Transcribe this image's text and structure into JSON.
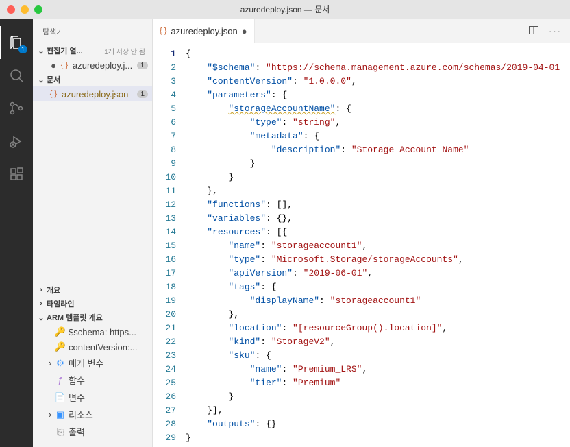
{
  "titlebar": {
    "title": "azuredeploy.json — 문서"
  },
  "activity": {
    "explorer_badge": "1"
  },
  "sidebar": {
    "title": "탐색기",
    "open_editors": {
      "label": "편집기 열...",
      "status": "1개 저장 안 됨",
      "file": "azuredeploy.j...",
      "count": "1"
    },
    "workspace": {
      "label": "문서",
      "file": "azuredeploy.json",
      "count": "1"
    },
    "outline_label": "개요",
    "timeline_label": "타임라인",
    "arm": {
      "label": "ARM 템플릿 개요",
      "items": [
        {
          "icon": "key",
          "label": "$schema: https..."
        },
        {
          "icon": "key",
          "label": "contentVersion:..."
        },
        {
          "icon": "gear",
          "label": "매개 변수",
          "expandable": true
        },
        {
          "icon": "func",
          "label": "함수"
        },
        {
          "icon": "doc",
          "label": "변수"
        },
        {
          "icon": "cube",
          "label": "리소스",
          "expandable": true
        },
        {
          "icon": "out",
          "label": "출력"
        }
      ]
    }
  },
  "tab": {
    "filename": "azuredeploy.json"
  },
  "code": {
    "lines": [
      {
        "n": 1,
        "t": [
          [
            "p",
            "{"
          ]
        ]
      },
      {
        "n": 2,
        "t": [
          [
            "p",
            "    "
          ],
          [
            "k",
            "\"$schema\""
          ],
          [
            "p",
            ": "
          ],
          [
            "url",
            "\"https://schema.management.azure.com/schemas/2019-04-01"
          ]
        ]
      },
      {
        "n": 3,
        "t": [
          [
            "p",
            "    "
          ],
          [
            "k",
            "\"contentVersion\""
          ],
          [
            "p",
            ": "
          ],
          [
            "s",
            "\"1.0.0.0\""
          ],
          [
            "p",
            ","
          ]
        ]
      },
      {
        "n": 4,
        "t": [
          [
            "p",
            "    "
          ],
          [
            "k",
            "\"parameters\""
          ],
          [
            "p",
            ": {"
          ]
        ]
      },
      {
        "n": 5,
        "t": [
          [
            "p",
            "        "
          ],
          [
            "ksq",
            "\"storageAccountName\""
          ],
          [
            "p",
            ": {"
          ]
        ]
      },
      {
        "n": 6,
        "t": [
          [
            "p",
            "            "
          ],
          [
            "k",
            "\"type\""
          ],
          [
            "p",
            ": "
          ],
          [
            "s",
            "\"string\""
          ],
          [
            "p",
            ","
          ]
        ]
      },
      {
        "n": 7,
        "t": [
          [
            "p",
            "            "
          ],
          [
            "k",
            "\"metadata\""
          ],
          [
            "p",
            ": {"
          ]
        ]
      },
      {
        "n": 8,
        "t": [
          [
            "p",
            "                "
          ],
          [
            "k",
            "\"description\""
          ],
          [
            "p",
            ": "
          ],
          [
            "s",
            "\"Storage Account Name\""
          ]
        ]
      },
      {
        "n": 9,
        "t": [
          [
            "p",
            "            }"
          ]
        ]
      },
      {
        "n": 10,
        "t": [
          [
            "p",
            "        }"
          ]
        ]
      },
      {
        "n": 11,
        "t": [
          [
            "p",
            "    },"
          ]
        ]
      },
      {
        "n": 12,
        "t": [
          [
            "p",
            "    "
          ],
          [
            "k",
            "\"functions\""
          ],
          [
            "p",
            ": [],"
          ]
        ]
      },
      {
        "n": 13,
        "t": [
          [
            "p",
            "    "
          ],
          [
            "k",
            "\"variables\""
          ],
          [
            "p",
            ": {},"
          ]
        ]
      },
      {
        "n": 14,
        "t": [
          [
            "p",
            "    "
          ],
          [
            "k",
            "\"resources\""
          ],
          [
            "p",
            ": [{"
          ]
        ]
      },
      {
        "n": 15,
        "t": [
          [
            "p",
            "        "
          ],
          [
            "k",
            "\"name\""
          ],
          [
            "p",
            ": "
          ],
          [
            "s",
            "\"storageaccount1\""
          ],
          [
            "p",
            ","
          ]
        ]
      },
      {
        "n": 16,
        "t": [
          [
            "p",
            "        "
          ],
          [
            "k",
            "\"type\""
          ],
          [
            "p",
            ": "
          ],
          [
            "s",
            "\"Microsoft.Storage/storageAccounts\""
          ],
          [
            "p",
            ","
          ]
        ]
      },
      {
        "n": 17,
        "t": [
          [
            "p",
            "        "
          ],
          [
            "k",
            "\"apiVersion\""
          ],
          [
            "p",
            ": "
          ],
          [
            "s",
            "\"2019-06-01\""
          ],
          [
            "p",
            ","
          ]
        ]
      },
      {
        "n": 18,
        "t": [
          [
            "p",
            "        "
          ],
          [
            "k",
            "\"tags\""
          ],
          [
            "p",
            ": {"
          ]
        ]
      },
      {
        "n": 19,
        "t": [
          [
            "p",
            "            "
          ],
          [
            "k",
            "\"displayName\""
          ],
          [
            "p",
            ": "
          ],
          [
            "s",
            "\"storageaccount1\""
          ]
        ]
      },
      {
        "n": 20,
        "t": [
          [
            "p",
            "        },"
          ]
        ]
      },
      {
        "n": 21,
        "t": [
          [
            "p",
            "        "
          ],
          [
            "k",
            "\"location\""
          ],
          [
            "p",
            ": "
          ],
          [
            "s",
            "\"[resourceGroup().location]\""
          ],
          [
            "p",
            ","
          ]
        ]
      },
      {
        "n": 22,
        "t": [
          [
            "p",
            "        "
          ],
          [
            "k",
            "\"kind\""
          ],
          [
            "p",
            ": "
          ],
          [
            "s",
            "\"StorageV2\""
          ],
          [
            "p",
            ","
          ]
        ]
      },
      {
        "n": 23,
        "t": [
          [
            "p",
            "        "
          ],
          [
            "k",
            "\"sku\""
          ],
          [
            "p",
            ": {"
          ]
        ]
      },
      {
        "n": 24,
        "t": [
          [
            "p",
            "            "
          ],
          [
            "k",
            "\"name\""
          ],
          [
            "p",
            ": "
          ],
          [
            "s",
            "\"Premium_LRS\""
          ],
          [
            "p",
            ","
          ]
        ]
      },
      {
        "n": 25,
        "t": [
          [
            "p",
            "            "
          ],
          [
            "k",
            "\"tier\""
          ],
          [
            "p",
            ": "
          ],
          [
            "s",
            "\"Premium\""
          ]
        ]
      },
      {
        "n": 26,
        "t": [
          [
            "p",
            "        }"
          ]
        ]
      },
      {
        "n": 27,
        "t": [
          [
            "p",
            "    }],"
          ]
        ]
      },
      {
        "n": 28,
        "t": [
          [
            "p",
            "    "
          ],
          [
            "k",
            "\"outputs\""
          ],
          [
            "p",
            ": {}"
          ]
        ]
      },
      {
        "n": 29,
        "t": [
          [
            "p",
            "}"
          ]
        ]
      }
    ]
  }
}
